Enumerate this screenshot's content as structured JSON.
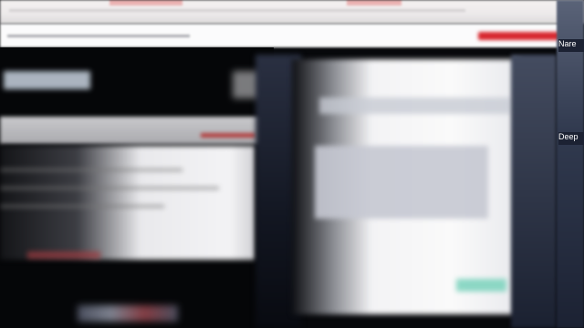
{
  "right_rail": {
    "labels": [
      "Nare",
      "Deep"
    ]
  },
  "colors": {
    "background": "#07080b",
    "accent_red": "#d7262d",
    "accent_green": "#7fd4bf",
    "rail": "#313a4f"
  },
  "icons": []
}
